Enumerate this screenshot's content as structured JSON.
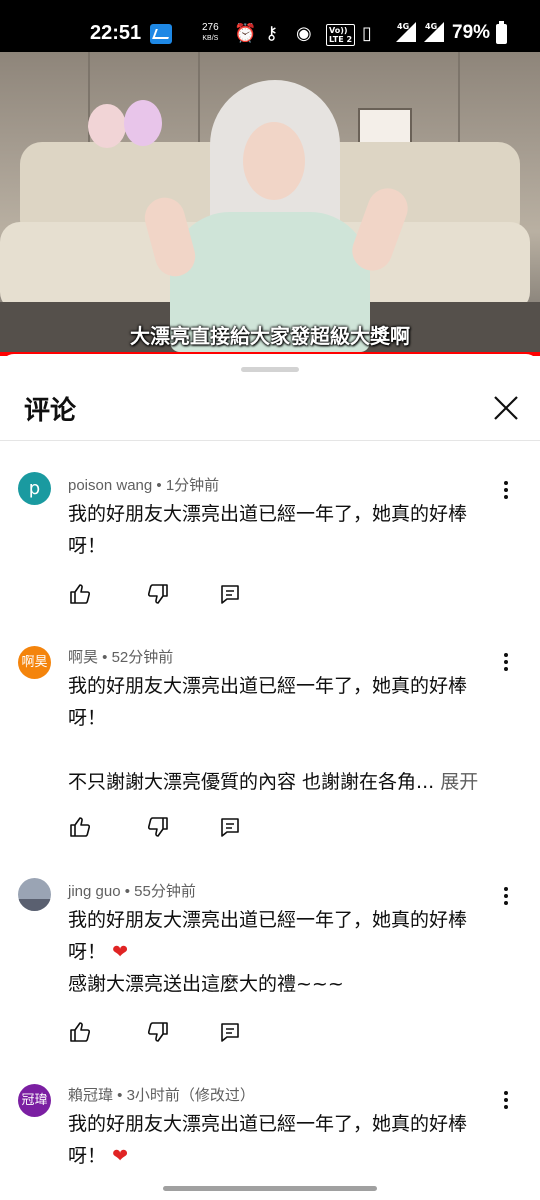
{
  "status_bar": {
    "time": "22:51",
    "speed_value": "276",
    "speed_unit": "KB/S",
    "volte_line1": "Vo))",
    "volte_line2": "LTE 2",
    "net1": "4G",
    "net2": "4G",
    "battery": "79%"
  },
  "video": {
    "subtitle": "大漂亮直接給大家發超級大獎啊"
  },
  "comments_sheet": {
    "title": "评论",
    "comments": [
      {
        "avatar_letter": "p",
        "meta": "poison wang • 1分钟前",
        "lines": [
          "我的好朋友大漂亮出道已經一年了，她真的好棒",
          "呀！"
        ]
      },
      {
        "avatar_letter": "啊昊",
        "meta": "啊昊 • 52分钟前",
        "lines": [
          "我的好朋友大漂亮出道已經一年了，她真的好棒",
          "呀！",
          "不只謝謝大漂亮優質的內容  也謝謝在各角..."
        ],
        "expand_label": "展开"
      },
      {
        "avatar_letter": "",
        "meta": "jing guo • 55分钟前",
        "lines": [
          "我的好朋友大漂亮出道已經一年了，她真的好棒",
          "呀！",
          "感謝大漂亮送出這麼大的禮~~~"
        ]
      },
      {
        "avatar_letter": "冠瑋",
        "meta": "賴冠瑋 • 3小时前（修改过）",
        "lines": [
          "我的好朋友大漂亮出道已經一年了，她真的好棒",
          "呀！"
        ]
      }
    ]
  },
  "colors": {
    "accent_red": "#ff0000",
    "avatar_p": "#1a9aa0",
    "avatar_ahao": "#f4840c",
    "avatar_guanwei": "#7b1fa2",
    "heart": "#e02424"
  }
}
